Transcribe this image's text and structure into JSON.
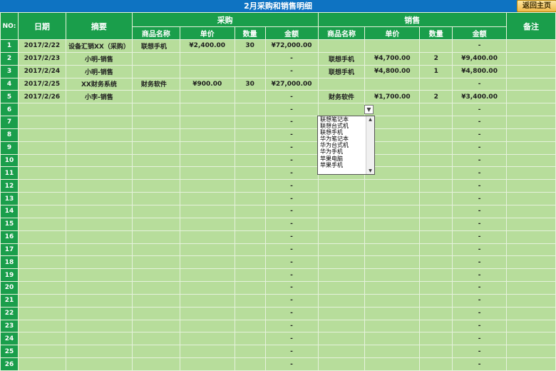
{
  "title": "2月采购和销售明细",
  "back_button": "返回主页",
  "header": {
    "no": "NO:",
    "date": "日期",
    "summary": "摘要",
    "purchase": "采购",
    "sales": "销售",
    "remark": "备注",
    "product_name": "商品名称",
    "unit_price": "单价",
    "quantity": "数量",
    "amount": "金额"
  },
  "rows": [
    {
      "no": "1",
      "date": "2017/2/22",
      "summary": "设备汇销XX（采购）",
      "p_name": "联想手机",
      "p_price": "¥2,400.00",
      "p_qty": "30",
      "p_amount": "¥72,000.00",
      "s_name": "",
      "s_price": "",
      "s_qty": "",
      "s_amount": "-"
    },
    {
      "no": "2",
      "date": "2017/2/23",
      "summary": "小明-销售",
      "p_name": "",
      "p_price": "",
      "p_qty": "",
      "p_amount": "-",
      "s_name": "联想手机",
      "s_price": "¥4,700.00",
      "s_qty": "2",
      "s_amount": "¥9,400.00"
    },
    {
      "no": "3",
      "date": "2017/2/24",
      "summary": "小明-销售",
      "p_name": "",
      "p_price": "",
      "p_qty": "",
      "p_amount": "-",
      "s_name": "联想手机",
      "s_price": "¥4,800.00",
      "s_qty": "1",
      "s_amount": "¥4,800.00"
    },
    {
      "no": "4",
      "date": "2017/2/25",
      "summary": "XX财务系统",
      "p_name": "财务软件",
      "p_price": "¥900.00",
      "p_qty": "30",
      "p_amount": "¥27,000.00",
      "s_name": "",
      "s_price": "",
      "s_qty": "",
      "s_amount": "-"
    },
    {
      "no": "5",
      "date": "2017/2/26",
      "summary": "小李-销售",
      "p_name": "",
      "p_price": "",
      "p_qty": "",
      "p_amount": "-",
      "s_name": "财务软件",
      "s_price": "¥1,700.00",
      "s_qty": "2",
      "s_amount": "¥3,400.00"
    },
    {
      "no": "6",
      "date": "",
      "summary": "",
      "p_name": "",
      "p_price": "",
      "p_qty": "",
      "p_amount": "-",
      "s_name": "",
      "s_price": "",
      "s_qty": "",
      "s_amount": "-"
    },
    {
      "no": "7",
      "date": "",
      "summary": "",
      "p_name": "",
      "p_price": "",
      "p_qty": "",
      "p_amount": "-",
      "s_name": "",
      "s_price": "",
      "s_qty": "",
      "s_amount": "-"
    },
    {
      "no": "8",
      "date": "",
      "summary": "",
      "p_name": "",
      "p_price": "",
      "p_qty": "",
      "p_amount": "-",
      "s_name": "",
      "s_price": "",
      "s_qty": "",
      "s_amount": "-"
    },
    {
      "no": "9",
      "date": "",
      "summary": "",
      "p_name": "",
      "p_price": "",
      "p_qty": "",
      "p_amount": "-",
      "s_name": "",
      "s_price": "",
      "s_qty": "",
      "s_amount": "-"
    },
    {
      "no": "10",
      "date": "",
      "summary": "",
      "p_name": "",
      "p_price": "",
      "p_qty": "",
      "p_amount": "-",
      "s_name": "",
      "s_price": "",
      "s_qty": "",
      "s_amount": "-"
    },
    {
      "no": "11",
      "date": "",
      "summary": "",
      "p_name": "",
      "p_price": "",
      "p_qty": "",
      "p_amount": "-",
      "s_name": "",
      "s_price": "",
      "s_qty": "",
      "s_amount": "-"
    },
    {
      "no": "12",
      "date": "",
      "summary": "",
      "p_name": "",
      "p_price": "",
      "p_qty": "",
      "p_amount": "-",
      "s_name": "",
      "s_price": "",
      "s_qty": "",
      "s_amount": "-"
    },
    {
      "no": "13",
      "date": "",
      "summary": "",
      "p_name": "",
      "p_price": "",
      "p_qty": "",
      "p_amount": "-",
      "s_name": "",
      "s_price": "",
      "s_qty": "",
      "s_amount": "-"
    },
    {
      "no": "14",
      "date": "",
      "summary": "",
      "p_name": "",
      "p_price": "",
      "p_qty": "",
      "p_amount": "-",
      "s_name": "",
      "s_price": "",
      "s_qty": "",
      "s_amount": "-"
    },
    {
      "no": "15",
      "date": "",
      "summary": "",
      "p_name": "",
      "p_price": "",
      "p_qty": "",
      "p_amount": "-",
      "s_name": "",
      "s_price": "",
      "s_qty": "",
      "s_amount": "-"
    },
    {
      "no": "16",
      "date": "",
      "summary": "",
      "p_name": "",
      "p_price": "",
      "p_qty": "",
      "p_amount": "-",
      "s_name": "",
      "s_price": "",
      "s_qty": "",
      "s_amount": "-"
    },
    {
      "no": "17",
      "date": "",
      "summary": "",
      "p_name": "",
      "p_price": "",
      "p_qty": "",
      "p_amount": "-",
      "s_name": "",
      "s_price": "",
      "s_qty": "",
      "s_amount": "-"
    },
    {
      "no": "18",
      "date": "",
      "summary": "",
      "p_name": "",
      "p_price": "",
      "p_qty": "",
      "p_amount": "-",
      "s_name": "",
      "s_price": "",
      "s_qty": "",
      "s_amount": "-"
    },
    {
      "no": "19",
      "date": "",
      "summary": "",
      "p_name": "",
      "p_price": "",
      "p_qty": "",
      "p_amount": "-",
      "s_name": "",
      "s_price": "",
      "s_qty": "",
      "s_amount": "-"
    },
    {
      "no": "20",
      "date": "",
      "summary": "",
      "p_name": "",
      "p_price": "",
      "p_qty": "",
      "p_amount": "-",
      "s_name": "",
      "s_price": "",
      "s_qty": "",
      "s_amount": "-"
    },
    {
      "no": "21",
      "date": "",
      "summary": "",
      "p_name": "",
      "p_price": "",
      "p_qty": "",
      "p_amount": "-",
      "s_name": "",
      "s_price": "",
      "s_qty": "",
      "s_amount": "-"
    },
    {
      "no": "22",
      "date": "",
      "summary": "",
      "p_name": "",
      "p_price": "",
      "p_qty": "",
      "p_amount": "-",
      "s_name": "",
      "s_price": "",
      "s_qty": "",
      "s_amount": "-"
    },
    {
      "no": "23",
      "date": "",
      "summary": "",
      "p_name": "",
      "p_price": "",
      "p_qty": "",
      "p_amount": "-",
      "s_name": "",
      "s_price": "",
      "s_qty": "",
      "s_amount": "-"
    },
    {
      "no": "24",
      "date": "",
      "summary": "",
      "p_name": "",
      "p_price": "",
      "p_qty": "",
      "p_amount": "-",
      "s_name": "",
      "s_price": "",
      "s_qty": "",
      "s_amount": "-"
    },
    {
      "no": "25",
      "date": "",
      "summary": "",
      "p_name": "",
      "p_price": "",
      "p_qty": "",
      "p_amount": "-",
      "s_name": "",
      "s_price": "",
      "s_qty": "",
      "s_amount": "-"
    },
    {
      "no": "26",
      "date": "",
      "summary": "",
      "p_name": "",
      "p_price": "",
      "p_qty": "",
      "p_amount": "-",
      "s_name": "",
      "s_price": "",
      "s_qty": "",
      "s_amount": "-"
    }
  ],
  "dropdown": {
    "options": [
      "联想笔记本",
      "联想台式机",
      "联想手机",
      "华为笔记本",
      "华为台式机",
      "华为手机",
      "苹果电脑",
      "苹果手机"
    ]
  }
}
